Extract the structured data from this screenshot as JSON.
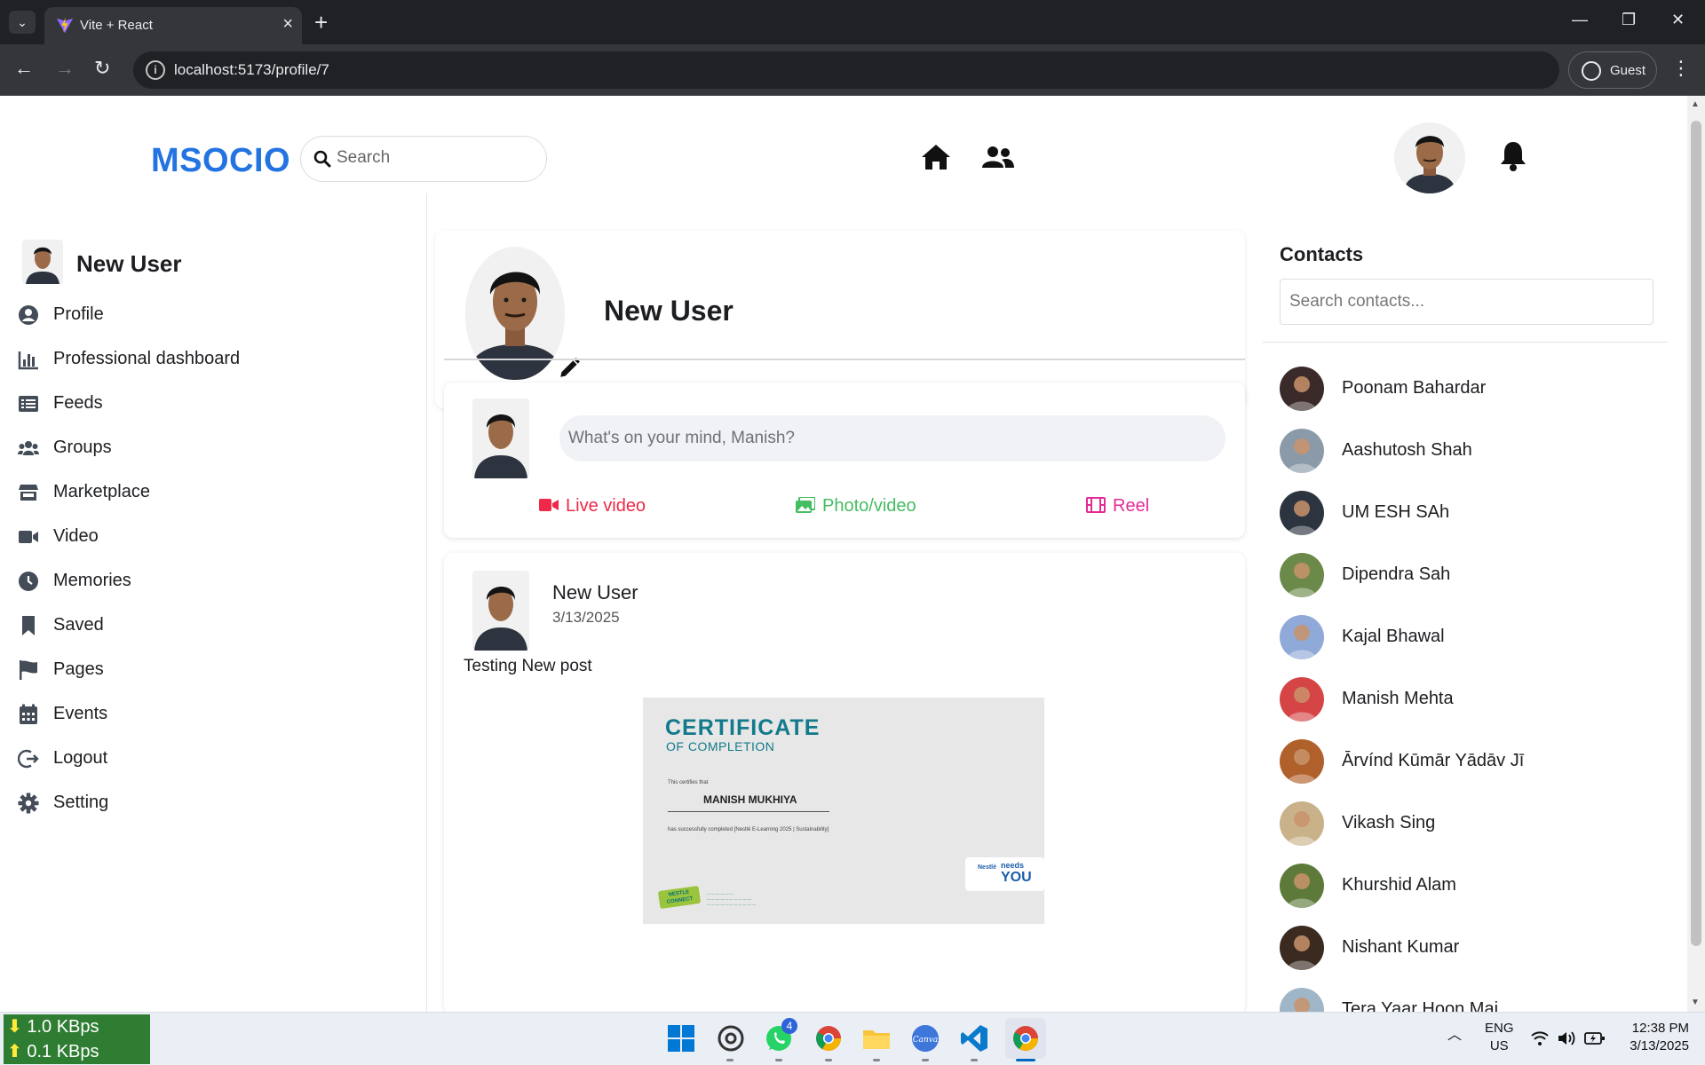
{
  "browser": {
    "tab_title": "Vite + React",
    "url": "localhost:5173/profile/7",
    "profile_label": "Guest"
  },
  "header": {
    "logo": "MSOCIO",
    "search_placeholder": "Search"
  },
  "sidebar": {
    "user_name": "New User",
    "items": [
      {
        "label": "Profile",
        "icon": "user-circle-icon"
      },
      {
        "label": "Professional dashboard",
        "icon": "bar-chart-icon"
      },
      {
        "label": "Feeds",
        "icon": "list-icon"
      },
      {
        "label": "Groups",
        "icon": "users-icon"
      },
      {
        "label": "Marketplace",
        "icon": "store-icon"
      },
      {
        "label": "Video",
        "icon": "video-camera-icon"
      },
      {
        "label": "Memories",
        "icon": "clock-icon"
      },
      {
        "label": "Saved",
        "icon": "bookmark-icon"
      },
      {
        "label": "Pages",
        "icon": "flag-icon"
      },
      {
        "label": "Events",
        "icon": "calendar-icon"
      },
      {
        "label": "Logout",
        "icon": "logout-icon"
      },
      {
        "label": "Setting",
        "icon": "gear-icon"
      }
    ]
  },
  "profile": {
    "name": "New User"
  },
  "composer": {
    "placeholder": "What's on your mind, Manish?",
    "actions": [
      {
        "label": "Live video",
        "color": "#f02849",
        "icon": "video-camera-icon"
      },
      {
        "label": "Photo/video",
        "color": "#45bd62",
        "icon": "photos-icon"
      },
      {
        "label": "Reel",
        "color": "#e42a97",
        "icon": "film-icon"
      }
    ]
  },
  "post": {
    "author": "New User",
    "date": "3/13/2025",
    "text": "Testing New post",
    "certificate": {
      "title": "CERTIFICATE",
      "subtitle": "OF COMPLETION",
      "certifies": "This certifies that",
      "recipient": "MANISH MUKHIYA",
      "completed": "has successfully completed [Nestlé E-Learning 2025 | Sustainability]",
      "badge": "NESTLE CONNECT",
      "brand": "Nestlé",
      "needs": "needs",
      "you": "YOU"
    }
  },
  "contacts": {
    "title": "Contacts",
    "search_placeholder": "Search contacts...",
    "list": [
      {
        "name": "Poonam Bahardar",
        "color": "#3a2a2a"
      },
      {
        "name": "Aashutosh Shah",
        "color": "#8a9aa8"
      },
      {
        "name": "UM ESH SAh",
        "color": "#2c3440"
      },
      {
        "name": "Dipendra Sah",
        "color": "#6b8a4a"
      },
      {
        "name": "Kajal Bhawal",
        "color": "#8fa9d8"
      },
      {
        "name": "Manish Mehta",
        "color": "#d64545"
      },
      {
        "name": "Ārvínd Kūmār Yādāv Jī",
        "color": "#b0602a"
      },
      {
        "name": "Vikash Sing",
        "color": "#c9b28a"
      },
      {
        "name": "Khurshid Alam",
        "color": "#5e7a3a"
      },
      {
        "name": "Nishant Kumar",
        "color": "#3a2a20"
      },
      {
        "name": "Tera Yaar Hoon Mai",
        "color": "#9fb6c8"
      }
    ]
  },
  "taskbar": {
    "net_down": "1.0 KBps",
    "net_up": "0.1 KBps",
    "whatsapp_badge": "4",
    "lang": "ENG",
    "region": "US",
    "time": "12:38 PM",
    "date": "3/13/2025"
  }
}
